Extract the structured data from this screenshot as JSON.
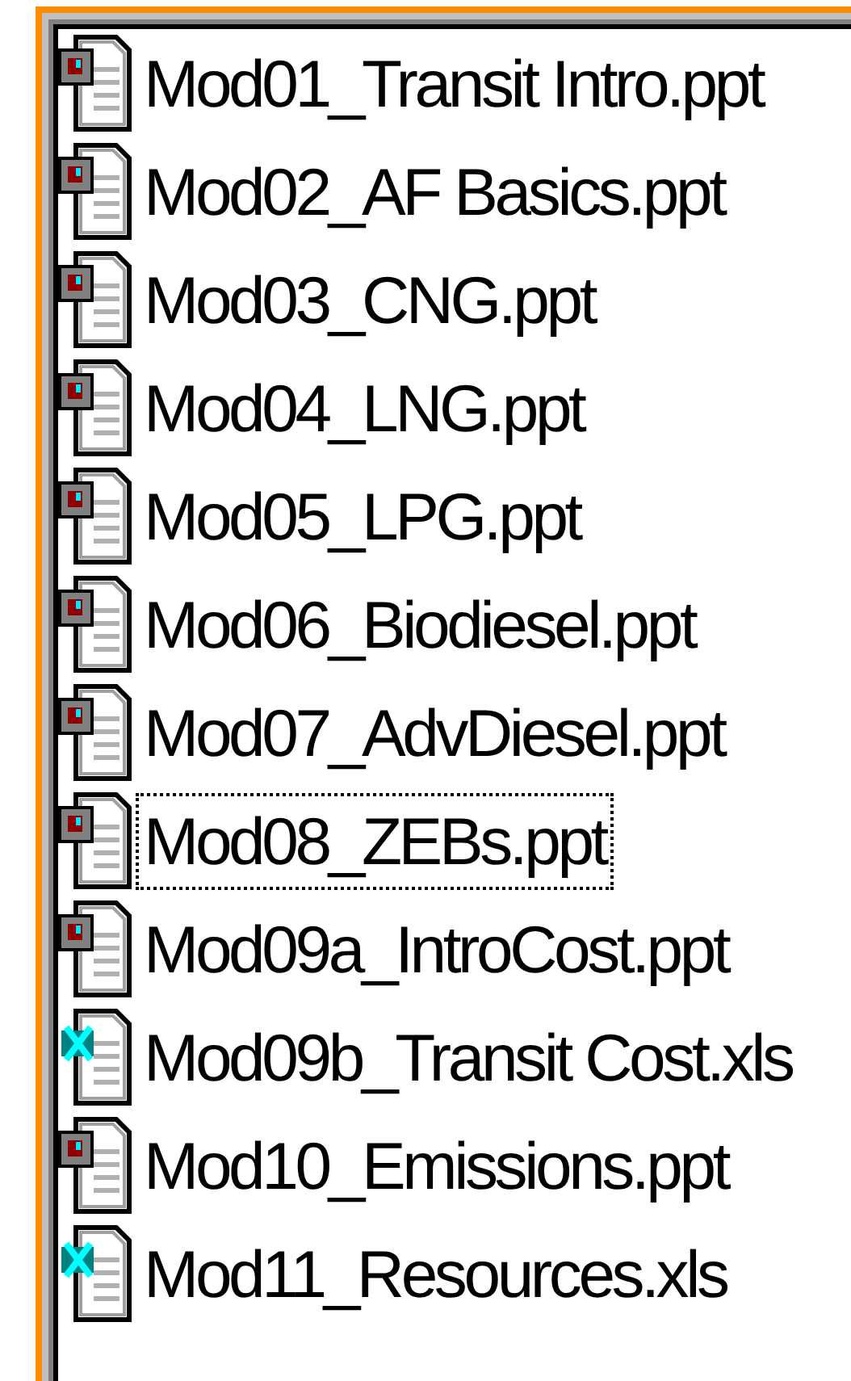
{
  "files": [
    {
      "name": "Mod01_Transit Intro.ppt",
      "kind": "presentation",
      "focused": false
    },
    {
      "name": "Mod02_AF Basics.ppt",
      "kind": "presentation",
      "focused": false
    },
    {
      "name": "Mod03_CNG.ppt",
      "kind": "presentation",
      "focused": false
    },
    {
      "name": "Mod04_LNG.ppt",
      "kind": "presentation",
      "focused": false
    },
    {
      "name": "Mod05_LPG.ppt",
      "kind": "presentation",
      "focused": false
    },
    {
      "name": "Mod06_Biodiesel.ppt",
      "kind": "presentation",
      "focused": false
    },
    {
      "name": "Mod07_AdvDiesel.ppt",
      "kind": "presentation",
      "focused": false
    },
    {
      "name": "Mod08_ZEBs.ppt",
      "kind": "presentation",
      "focused": true
    },
    {
      "name": "Mod09a_IntroCost.ppt",
      "kind": "presentation",
      "focused": false
    },
    {
      "name": "Mod09b_Transit Cost.xls",
      "kind": "spreadsheet",
      "focused": false
    },
    {
      "name": "Mod10_Emissions.ppt",
      "kind": "presentation",
      "focused": false
    },
    {
      "name": "Mod11_Resources.xls",
      "kind": "spreadsheet",
      "focused": false
    }
  ]
}
